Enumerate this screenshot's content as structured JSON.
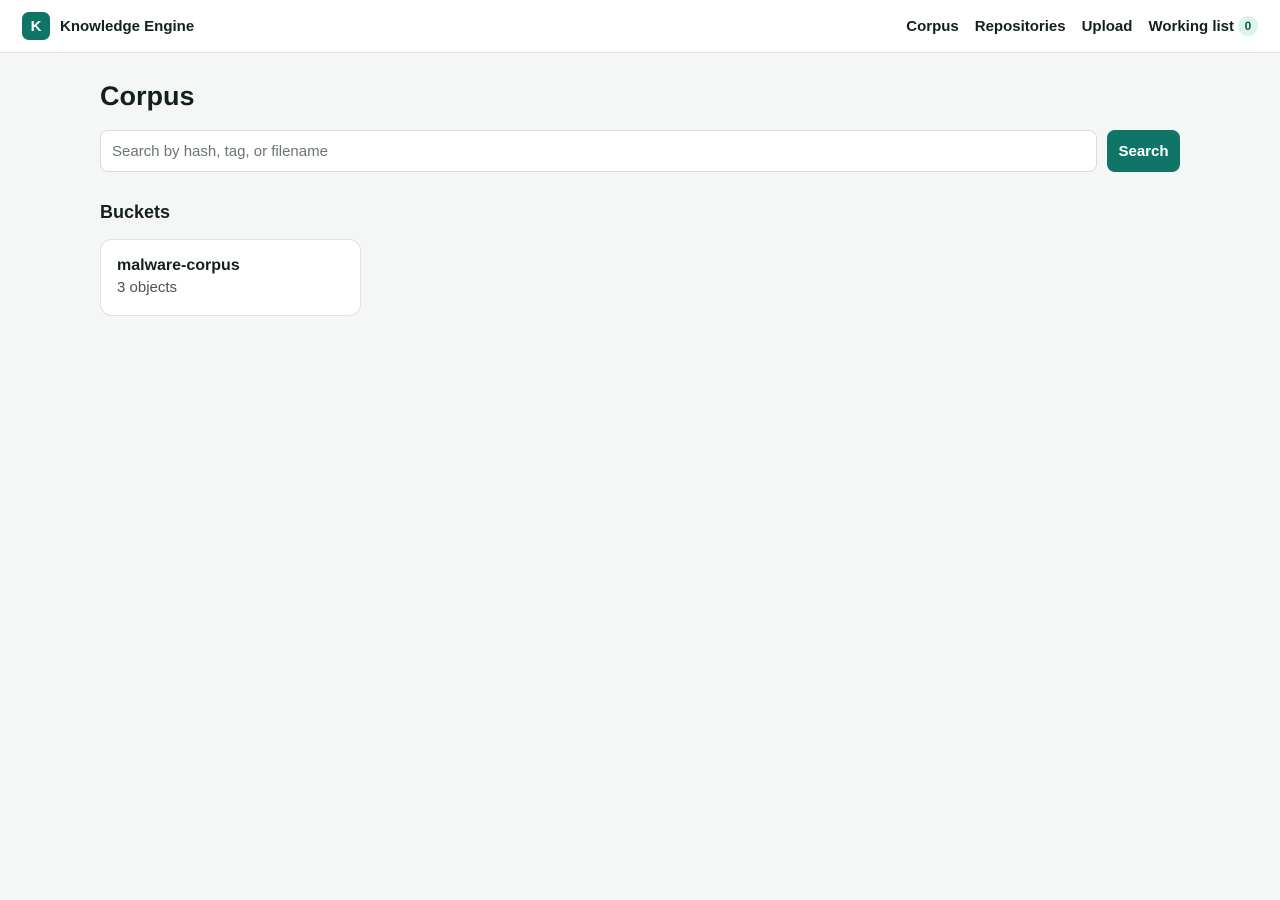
{
  "header": {
    "logo_letter": "K",
    "app_name": "Knowledge Engine",
    "nav": [
      {
        "label": "Corpus"
      },
      {
        "label": "Repositories"
      },
      {
        "label": "Upload"
      },
      {
        "label": "Working list",
        "badge": "0"
      }
    ]
  },
  "main": {
    "title": "Corpus",
    "search": {
      "placeholder": "Search by hash, tag, or filename",
      "value": "",
      "button_label": "Search"
    },
    "buckets_title": "Buckets",
    "buckets": [
      {
        "name": "malware-corpus",
        "count": "3 objects"
      }
    ]
  },
  "colors": {
    "accent": "#0f7566",
    "background": "#f5f7f6",
    "badge_bg": "#dcf3ec"
  }
}
